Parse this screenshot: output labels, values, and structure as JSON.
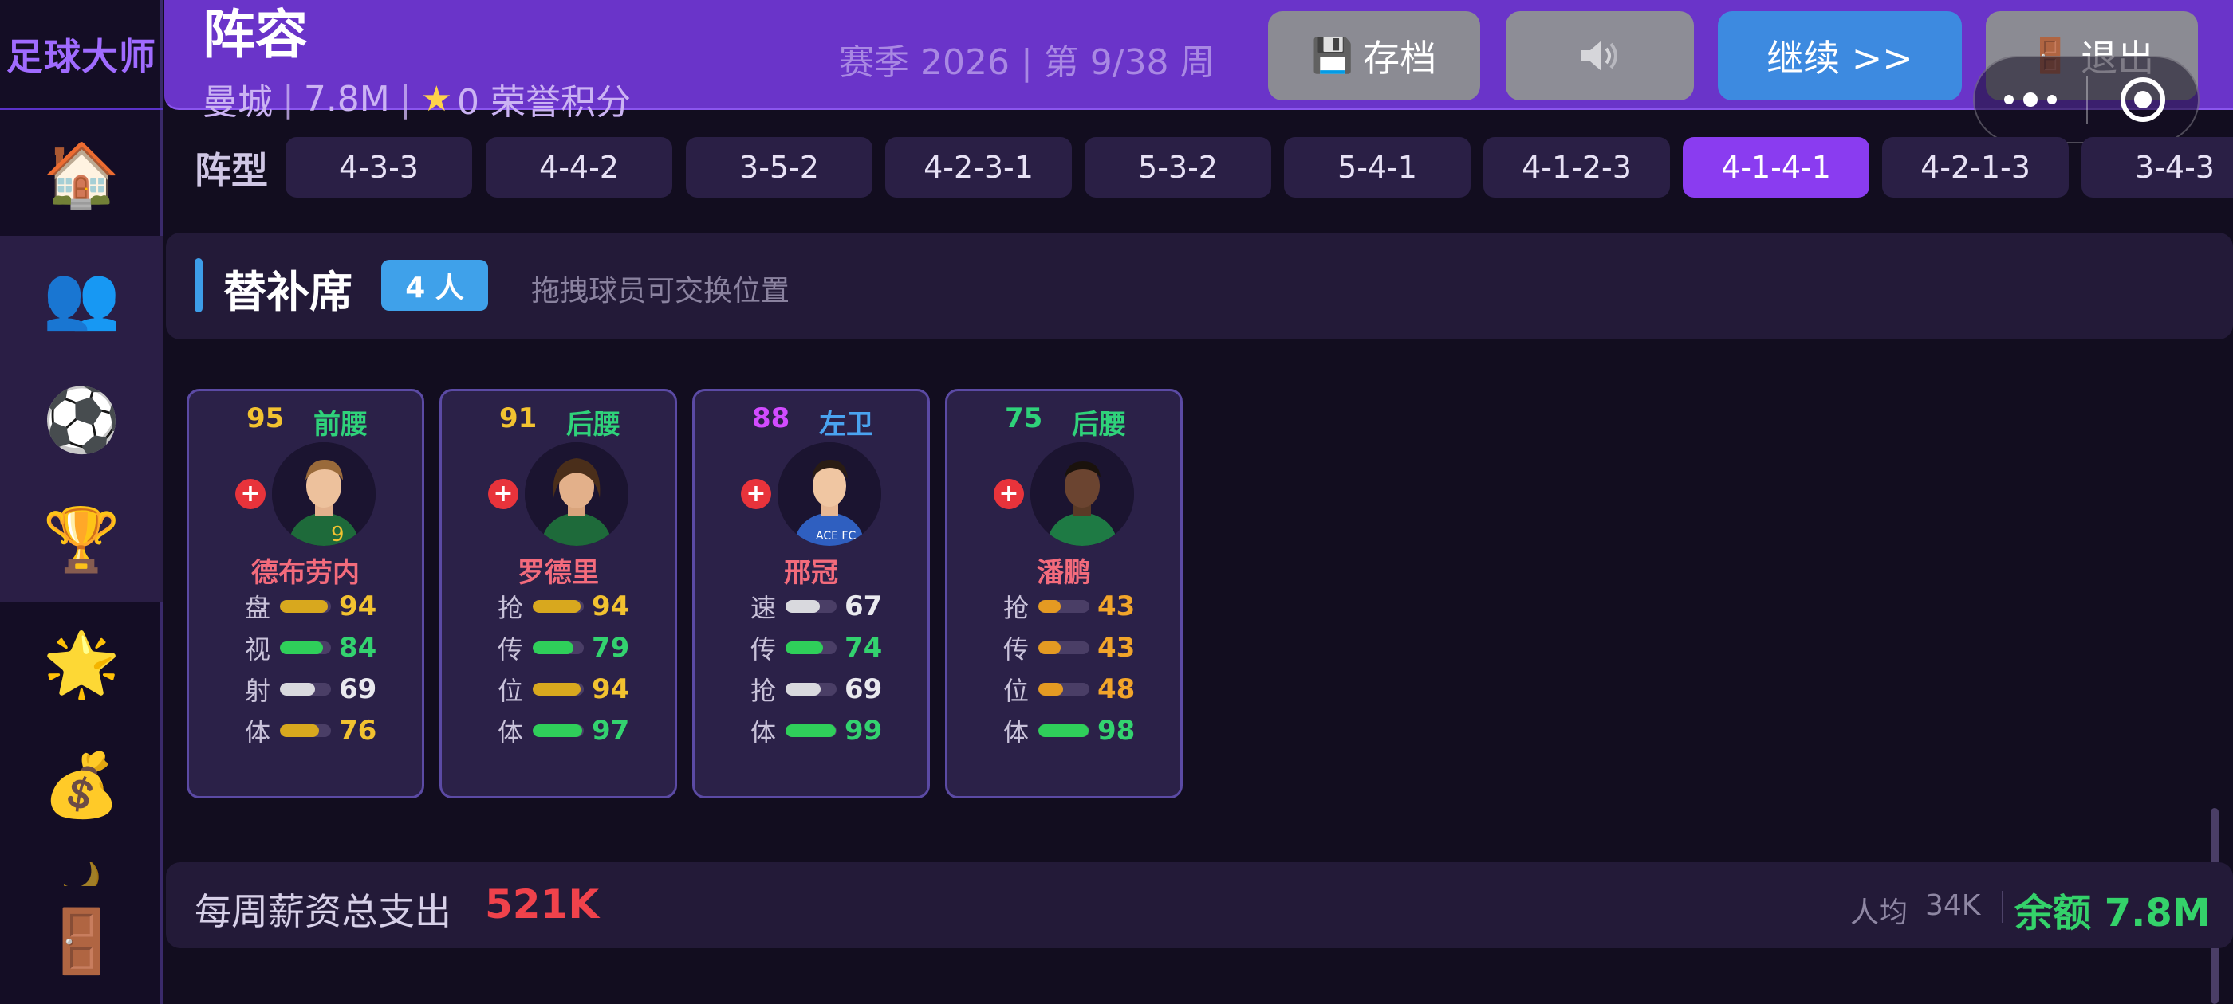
{
  "app": {
    "brand": "足球大师",
    "title": "阵容",
    "club": "曼城",
    "budget": "7.8M",
    "honor_points": "0 荣誉积分",
    "season": "赛季 2026 | 第 9/38 周"
  },
  "header_buttons": {
    "save": "存档",
    "continue": "继续 >>",
    "exit": "退出"
  },
  "sidebar": {
    "items": [
      {
        "icon": "house-icon",
        "glyph": "🏠"
      },
      {
        "icon": "players-icon",
        "glyph": "👥"
      },
      {
        "icon": "soccer-ball-icon",
        "glyph": "⚽"
      },
      {
        "icon": "trophy-icon",
        "glyph": "🏆"
      },
      {
        "icon": "star-icon",
        "glyph": "🌟"
      },
      {
        "icon": "money-bag-icon",
        "glyph": "💰"
      },
      {
        "icon": "partial-icon",
        "glyph": "🌙"
      },
      {
        "icon": "door-icon",
        "glyph": "🚪"
      }
    ]
  },
  "formation": {
    "label": "阵型",
    "options": [
      "4-3-3",
      "4-4-2",
      "3-5-2",
      "4-2-3-1",
      "5-3-2",
      "5-4-1",
      "4-1-2-3",
      "4-1-4-1",
      "4-2-1-3",
      "3-4-3"
    ],
    "selected": "4-1-4-1"
  },
  "bench": {
    "title": "替补席",
    "count": "4 人",
    "hint": "拖拽球员可交换位置"
  },
  "players": [
    {
      "rating": "95",
      "position": "前腰",
      "name": "德布劳内",
      "stats": [
        {
          "label": "盘",
          "value": "94",
          "color": "gold",
          "fill": 0.94
        },
        {
          "label": "视",
          "value": "84",
          "color": "green",
          "fill": 0.84
        },
        {
          "label": "射",
          "value": "69",
          "color": "white",
          "fill": 0.69
        },
        {
          "label": "体",
          "value": "76",
          "color": "gold",
          "fill": 0.76
        }
      ]
    },
    {
      "rating": "91",
      "position": "后腰",
      "name": "罗德里",
      "stats": [
        {
          "label": "抢",
          "value": "94",
          "color": "gold",
          "fill": 0.94
        },
        {
          "label": "传",
          "value": "79",
          "color": "green",
          "fill": 0.79
        },
        {
          "label": "位",
          "value": "94",
          "color": "gold",
          "fill": 0.94
        },
        {
          "label": "体",
          "value": "97",
          "color": "green",
          "fill": 0.97
        }
      ]
    },
    {
      "rating": "88",
      "position": "左卫",
      "name": "邢冠",
      "stats": [
        {
          "label": "速",
          "value": "67",
          "color": "white",
          "fill": 0.67
        },
        {
          "label": "传",
          "value": "74",
          "color": "green",
          "fill": 0.74
        },
        {
          "label": "抢",
          "value": "69",
          "color": "white",
          "fill": 0.69
        },
        {
          "label": "体",
          "value": "99",
          "color": "green",
          "fill": 0.99
        }
      ]
    },
    {
      "rating": "75",
      "position": "后腰",
      "name": "潘鹏",
      "stats": [
        {
          "label": "抢",
          "value": "43",
          "color": "orange",
          "fill": 0.43
        },
        {
          "label": "传",
          "value": "43",
          "color": "orange",
          "fill": 0.43
        },
        {
          "label": "位",
          "value": "48",
          "color": "orange",
          "fill": 0.48
        },
        {
          "label": "体",
          "value": "98",
          "color": "green",
          "fill": 0.98
        }
      ]
    }
  ],
  "footer": {
    "wage_label": "每周薪资总支出",
    "wage_value": "521K",
    "avg_label": "人均",
    "avg_value": "34K",
    "balance": "余额 7.8M"
  },
  "colors": {
    "header": "#6a34c9",
    "accent_purple": "#8a3cf0",
    "continue_blue": "#3d8ae0",
    "wage_red": "#f0424b",
    "balance_green": "#34d26a"
  }
}
